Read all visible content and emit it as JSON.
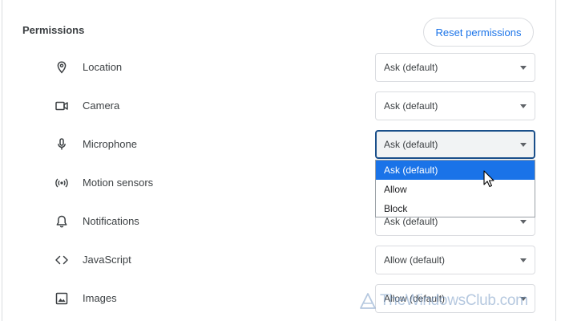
{
  "section": {
    "title": "Permissions",
    "reset_label": "Reset permissions"
  },
  "rows": [
    {
      "label": "Location",
      "value": "Ask (default)",
      "icon": "location-pin-icon"
    },
    {
      "label": "Camera",
      "value": "Ask (default)",
      "icon": "camera-icon"
    },
    {
      "label": "Microphone",
      "value": "Ask (default)",
      "icon": "microphone-icon"
    },
    {
      "label": "Motion sensors",
      "value": "",
      "icon": "motion-sensors-icon"
    },
    {
      "label": "Notifications",
      "value": "Ask (default)",
      "icon": "bell-icon"
    },
    {
      "label": "JavaScript",
      "value": "Allow (default)",
      "icon": "code-brackets-icon"
    },
    {
      "label": "Images",
      "value": "Allow (default)",
      "icon": "image-icon"
    }
  ],
  "dropdown": {
    "options": [
      "Ask (default)",
      "Allow",
      "Block"
    ],
    "selected": "Ask (default)"
  },
  "watermark": {
    "text": "TheWindowsClub.com"
  },
  "colors": {
    "accent": "#1a73e8",
    "focus_border": "#1a4f8a",
    "border": "#dadce0"
  }
}
